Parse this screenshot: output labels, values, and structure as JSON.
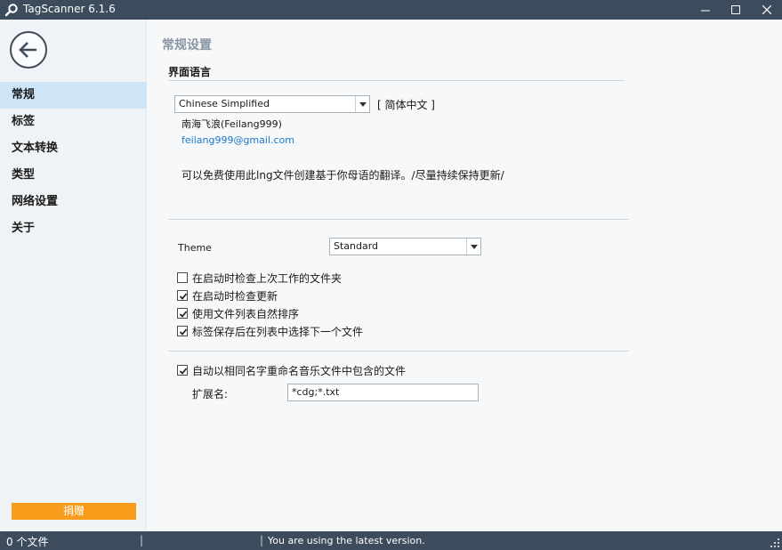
{
  "window": {
    "title": "TagScanner 6.1.6"
  },
  "sidebar": {
    "items": [
      {
        "label": "常规",
        "active": true
      },
      {
        "label": "标签",
        "active": false
      },
      {
        "label": "文本转换",
        "active": false
      },
      {
        "label": "类型",
        "active": false
      },
      {
        "label": "网络设置",
        "active": false
      },
      {
        "label": "关于",
        "active": false
      }
    ],
    "donate_label": "捐赠"
  },
  "main": {
    "page_title": "常规设置",
    "language_section_title": "界面语言",
    "language_select_value": "Chinese Simplified",
    "language_native": "[ 简体中文 ]",
    "translator": "南海飞浪(Feilang999)",
    "translator_email": "feilang999@gmail.com",
    "translation_note": "可以免费使用此lng文件创建基于你母语的翻译。/尽量持续保持更新/",
    "theme_label": "Theme",
    "theme_select_value": "Standard",
    "options": [
      {
        "label": "在启动时检查上次工作的文件夹",
        "checked": false
      },
      {
        "label": "在启动时检查更新",
        "checked": true
      },
      {
        "label": "使用文件列表自然排序",
        "checked": true
      },
      {
        "label": "标签保存后在列表中选择下一个文件",
        "checked": true
      }
    ],
    "rename_option": {
      "label": "自动以相同名字重命名音乐文件中包含的文件",
      "checked": true
    },
    "extensions_label": "扩展名:",
    "extensions_value": "*cdg;*.txt"
  },
  "statusbar": {
    "file_count": "0 个文件",
    "message": "You are using the latest version."
  },
  "colors": {
    "titlebar": "#3c4c5c",
    "active_nav": "#cde5f7",
    "donate": "#f99c1c",
    "link": "#1e78c8"
  }
}
